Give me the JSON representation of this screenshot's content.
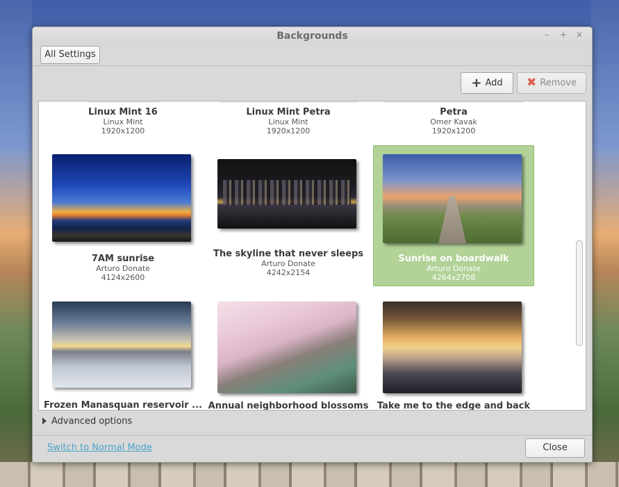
{
  "window": {
    "title": "Backgrounds",
    "controls": [
      "minimize",
      "maximize",
      "close"
    ]
  },
  "toolbar": {
    "all_settings_label": "All Settings",
    "add_label": "Add",
    "remove_label": "Remove"
  },
  "backgrounds": [
    {
      "name": "Linux Mint 16",
      "author": "Linux Mint",
      "resolution": "1920x1200"
    },
    {
      "name": "Linux Mint Petra",
      "author": "Linux Mint",
      "resolution": "1920x1200"
    },
    {
      "name": "Petra",
      "author": "Omer Kavak",
      "resolution": "1920x1200"
    },
    {
      "name": "7AM sunrise",
      "author": "Arturo Donate",
      "resolution": "4124x2600"
    },
    {
      "name": "The skyline that never sleeps",
      "author": "Arturo Donate",
      "resolution": "4242x2154"
    },
    {
      "name": "Sunrise on boardwalk",
      "author": "Arturo Donate",
      "resolution": "4264x2708",
      "selected": true
    },
    {
      "name": "Frozen Manasquan reservoir ...",
      "author": "",
      "resolution": ""
    },
    {
      "name": "Annual neighborhood blossoms",
      "author": "",
      "resolution": ""
    },
    {
      "name": "Take me to the edge and back",
      "author": "",
      "resolution": ""
    }
  ],
  "advanced_options_label": "Advanced options",
  "footer": {
    "switch_mode_label": "Switch to Normal Mode",
    "close_label": "Close"
  },
  "colors": {
    "selection": "#b2d298",
    "link": "#4aa3c8",
    "remove_icon": "#e06050"
  }
}
